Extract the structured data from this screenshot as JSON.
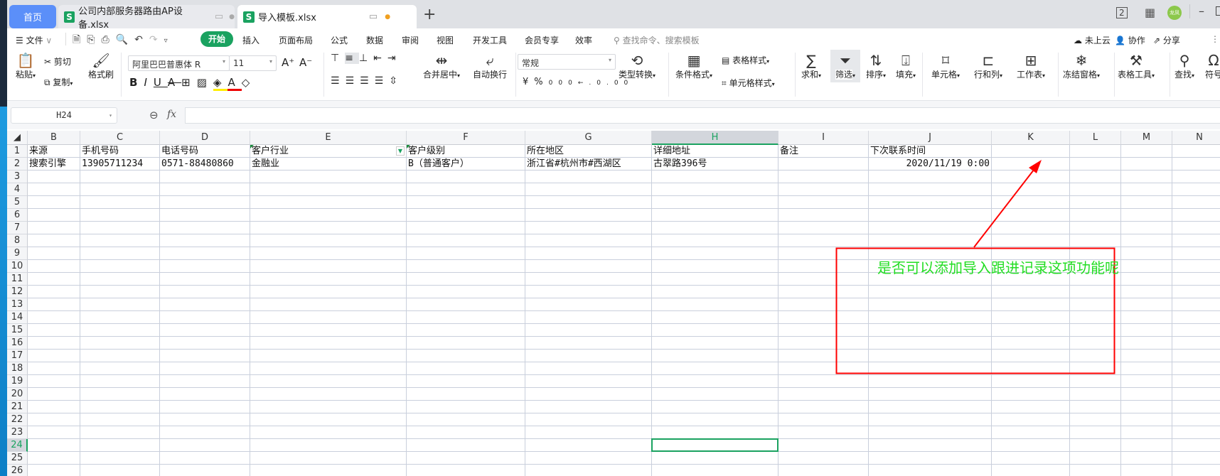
{
  "tabs": [
    {
      "label": "首页",
      "active": false
    },
    {
      "label": "公司内部服务器路由AP设备.xlsx",
      "active": false
    },
    {
      "label": "导入模板.xlsx",
      "active": true
    }
  ],
  "window": {
    "avatar_text": "龙凤",
    "new_tab": "+"
  },
  "menu": {
    "file": "文件",
    "items": [
      "开始",
      "插入",
      "页面布局",
      "公式",
      "数据",
      "审阅",
      "视图",
      "开发工具",
      "会员专享",
      "效率"
    ],
    "search_placeholder": "查找命令、搜索模板",
    "cloud": "未上云",
    "collab": "协作",
    "share": "分享"
  },
  "ribbon": {
    "paste": "粘贴",
    "cut": "剪切",
    "copy": "复制",
    "format_painter": "格式刷",
    "font_name": "阿里巴巴普惠体 R",
    "font_size": "11",
    "merge": "合并居中",
    "wrap": "自动换行",
    "number_format": "常规",
    "convert": "类型转换",
    "cond_format": "条件格式",
    "table_style": "表格样式",
    "cell_style": "单元格样式",
    "sum": "求和",
    "filter": "筛选",
    "sort": "排序",
    "fill": "填充",
    "cell": "单元格",
    "rowcol": "行和列",
    "sheet": "工作表",
    "freeze": "冻结窗格",
    "tools": "表格工具",
    "find": "查找",
    "symbol": "符号"
  },
  "formula_bar": {
    "name_box": "H24",
    "fx": "fx",
    "formula": ""
  },
  "sheet": {
    "columns": [
      "B",
      "C",
      "D",
      "E",
      "F",
      "G",
      "H",
      "I",
      "J",
      "K",
      "L",
      "M",
      "N"
    ],
    "selected_column": "H",
    "selected_row": 24,
    "active_cell": "H24",
    "row_count": 26,
    "rows": [
      [
        "来源",
        "手机号码",
        "电话号码",
        "客户行业",
        "客户级别",
        "所在地区",
        "详细地址",
        "备注",
        "下次联系时间",
        "",
        "",
        "",
        ""
      ],
      [
        "搜索引擎",
        "13905711234",
        "0571-88480860",
        "金融业",
        "B（普通客户）",
        "浙江省#杭州市#西湖区",
        "古翠路396号",
        "",
        "2020/11/19 0:00",
        "",
        "",
        "",
        ""
      ]
    ]
  },
  "annotation": {
    "text": "是否可以添加导入跟进记录这项功能呢",
    "box_color": "#ff0000",
    "text_color": "#22dd22"
  },
  "colors": {
    "accent": "#1aa260",
    "home_tab": "#5b8ff9"
  }
}
